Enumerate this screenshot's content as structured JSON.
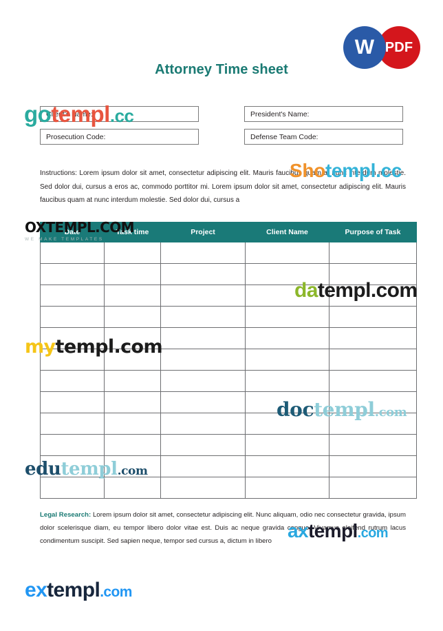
{
  "document": {
    "title": "Attorney Time sheet"
  },
  "badges": [
    {
      "id": "word",
      "label": "W",
      "color": "#2a5aa7"
    },
    {
      "id": "pdf",
      "label": "PDF",
      "color": "#d4161c"
    }
  ],
  "form": {
    "client_name": "Client's Name:",
    "president_name": "President's Name:",
    "prosecution_code": "Prosecution Code:",
    "defense_team_code": "Defense Team Code:"
  },
  "instructions": {
    "text": "Instructions: Lorem ipsum dolor sit amet, consectetur adipiscing elit. Mauris faucibus quam at nunc interdum molestie. Sed dolor dui, cursus a eros ac, commodo porttitor mi. Lorem ipsum dolor sit amet, consectetur adipiscing elit. Mauris faucibus quam at nunc interdum molestie. Sed dolor dui, cursus a"
  },
  "table": {
    "headers": [
      "Date",
      "Task time",
      "Project",
      "Client Name",
      "Purpose of Task"
    ],
    "row_count": 12,
    "header_bg": "#1a7a78",
    "header_text_color": "#ffffff",
    "border_color": "#6d6e71"
  },
  "legal": {
    "label": "Legal Research:",
    "text": " Lorem ipsum dolor sit amet, consectetur adipiscing elit. Nunc aliquam, odio nec consectetur gravida, ipsum dolor scelerisque diam, eu tempor libero dolor vitae est. Duis ac neque gravida congue. Vivamus eleifend rutrum lacus condimentum suscipit. Sed sapien neque, tempor sed cursus a, dictum in libero"
  },
  "watermarks": {
    "gotempl": {
      "p1": "go",
      "p2": "templ",
      "p3": ".cc"
    },
    "shotempl": {
      "p1": "Sho",
      "p2": "templ",
      "p3": ".cc"
    },
    "oxtempl": {
      "name": "OXTEMPL.COM",
      "tagline": "WE MAKE TEMPLATES"
    },
    "datempl": {
      "p1": "da",
      "p2": "templ.com"
    },
    "mytempl": {
      "p1": "my",
      "p2": "templ.com"
    },
    "doctempl": {
      "p1": "doc",
      "p2": "templ",
      "p3": ".com"
    },
    "edutempl": {
      "p1": "edu",
      "p2": "templ",
      "p3": ".com"
    },
    "axtempl": {
      "p1": "ax",
      "p2": "templ",
      "p3": ".com"
    },
    "extempl": {
      "p1": "ex",
      "p2": "templ",
      "p3": ".com"
    }
  }
}
